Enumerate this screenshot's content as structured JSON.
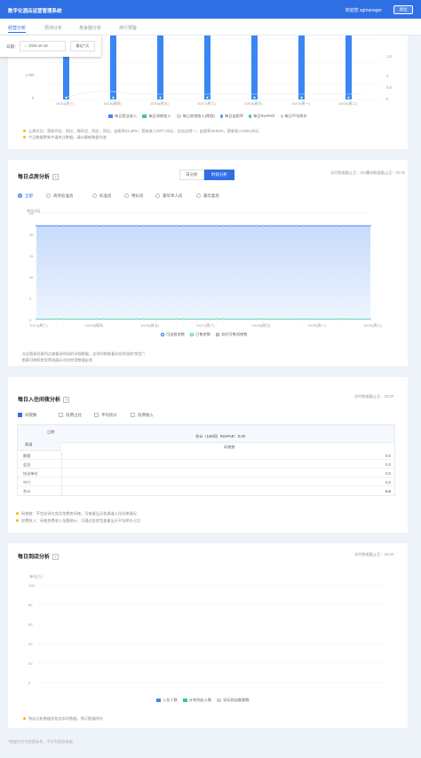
{
  "header": {
    "title": "数字化酒店运营管理系统",
    "user_label": "欢迎您 sgmanager",
    "logout": "退出"
  },
  "tabs": [
    "经营分析",
    "预测分析",
    "竞争圈分析",
    "排行预警"
  ],
  "date_filter": {
    "label": "日期：",
    "value": "2020-10-18",
    "preset": "最近7天"
  },
  "panel1": {
    "y_left_ticks": [
      "1,000",
      "0"
    ],
    "y_right_ticks": [
      "1.5",
      "1",
      "0.5",
      "0"
    ],
    "x_ticks": [
      "10/14(周三)",
      "10/15(周四)",
      "10/16(周五)",
      "10/17(周六)",
      "10/18(周日)",
      "10/19(周一)",
      "10/20(周二)"
    ],
    "legend": [
      "每日营业收入",
      "每日间夜收入",
      "每日其他收入(他收)",
      "每日出租率",
      "每日RevPAR",
      "每日平均房价"
    ],
    "notes": [
      "上周对比：营收环比、同比、周环比、同比、同比，出租率23.30%，营收收入2977.20元；住店比例—，出租率18.88%，营收收入3454.20元",
      "今日数据更新中请关注数据，请以最新数据为准"
    ]
  },
  "panel2": {
    "title": "每日点房分析",
    "help": "?",
    "toggle": [
      "日分析",
      "时段分析"
    ],
    "update_text": "实时数据截止至：02:00",
    "predict_text": "预测数据截止至：02:00",
    "options": [
      "全部",
      "商务标准房",
      "标准房",
      "特价房",
      "豪华单人房",
      "豪华套房"
    ],
    "y_unit": "单位(间)",
    "y_ticks": [
      "25",
      "20",
      "15",
      "10",
      "5",
      "0"
    ],
    "x_ticks": [
      "10/14(周三)",
      "10/15(周四)",
      "10/16(周五)",
      "10/17(周六)",
      "10/18(周日)",
      "10/19(周一)",
      "10/20(周二)"
    ],
    "legend": [
      "可出租房数",
      "已售房数",
      "实时可售间夜数"
    ],
    "notes": [
      "点击图表任意时点查看该时段的详细数据，支持切换查看对应时段的\"房型\"；",
      "图表可按照房型筛选展示对应房型数据走势"
    ]
  },
  "panel3": {
    "title": "每日入住间夜分析",
    "help": "?",
    "update_text": "实时数据截止至：02:00",
    "checks": [
      "间夜数",
      "房费占比",
      "平均房价",
      "房费收入"
    ],
    "table": {
      "corner_top": "日期",
      "corner_bottom": "渠道",
      "group_header": "合计（130间）RevPAR：0.00",
      "sub_header": "间夜数",
      "rows": [
        {
          "label": "散客",
          "value": "0.0"
        },
        {
          "label": "会员",
          "value": "0.0"
        },
        {
          "label": "协议单位",
          "value": "0.0"
        },
        {
          "label": "中介",
          "value": "0.0"
        },
        {
          "label": "合计",
          "value": "0.0"
        }
      ]
    },
    "notes": [
      "间夜数：不包含钟点房及免费房间夜，可查看当天各渠道入住间夜情况",
      "房费收入：间夜房费收入金额统计，可通过各房型查看当天平均房价占比"
    ]
  },
  "panel4": {
    "title": "每日到店分析",
    "help": "?",
    "update_text": "实时数据截止至：02:00",
    "y_unit": "单位(人)",
    "y_ticks": [
      "100",
      "80",
      "60",
      "40",
      "20",
      "0"
    ],
    "legend": [
      "入住人数",
      "计划到店人数",
      "实际到店散客数"
    ],
    "notes": [
      "到店分析数据仅包含实时数据，预订数据除外"
    ]
  },
  "footer": "*数据仅作为经营参考，不作为财务依据",
  "colors": {
    "primary": "#2f6fe4",
    "bar": "#3a86f5",
    "accent_green": "#3cc6a1",
    "note_bullet": "#f5b800"
  }
}
